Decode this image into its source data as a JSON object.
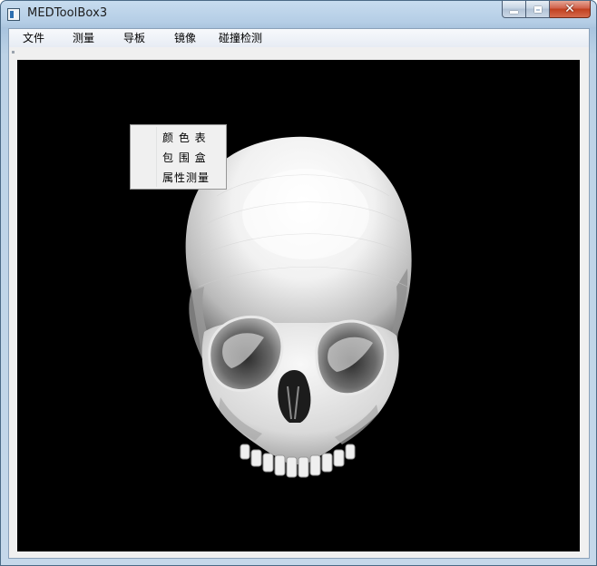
{
  "window": {
    "title": "MEDToolBox3",
    "icon": "app-window-icon",
    "controls": {
      "minimize": "minimize-icon",
      "maximize": "maximize-icon",
      "close": "close-icon"
    }
  },
  "menubar": {
    "items": [
      "文件",
      "测量",
      "导板",
      "镜像",
      "碰撞检测"
    ]
  },
  "context_menu": {
    "items": [
      "颜 色 表",
      "包 围 盒",
      "属性测量"
    ]
  },
  "viewport": {
    "background": "#000000",
    "content": "3d-skull-render"
  }
}
